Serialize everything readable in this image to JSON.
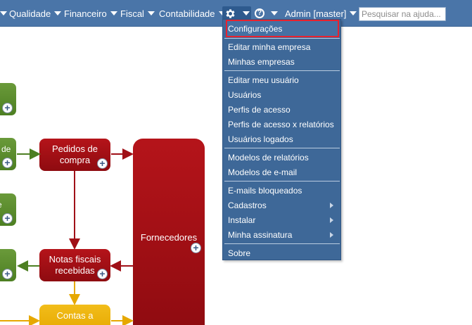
{
  "nav": {
    "items": [
      {
        "label": "Qualidade"
      },
      {
        "label": "Financeiro"
      },
      {
        "label": "Fiscal"
      },
      {
        "label": "Contabilidade"
      }
    ],
    "settings_icon": "gear-icon",
    "help_icon": "help-icon",
    "help_glyph": "?",
    "user_label": "Admin [master]",
    "search_placeholder": "Pesquisar na ajuda..."
  },
  "menu": {
    "items": [
      {
        "label": "Configurações",
        "highlighted": true
      },
      {
        "label": "Editar minha empresa"
      },
      {
        "label": "Minhas empresas"
      },
      {
        "label": "Editar meu usuário"
      },
      {
        "label": "Usuários"
      },
      {
        "label": "Perfis de acesso"
      },
      {
        "label": "Perfis de acesso x relatórios"
      },
      {
        "label": "Usuários logados"
      },
      {
        "label": "Modelos de relatórios"
      },
      {
        "label": "Modelos de e-mail"
      },
      {
        "label": "E-mails bloqueados"
      },
      {
        "label": "Cadastros",
        "submenu": true
      },
      {
        "label": "Instalar",
        "submenu": true
      },
      {
        "label": "Minha assinatura",
        "submenu": true
      },
      {
        "label": "Sobre"
      }
    ]
  },
  "flow": {
    "partial_label_de": "de",
    "partial_label_e": "e",
    "pedidos": "Pedidos de compra",
    "pedidos_line1": "Pedidos de",
    "pedidos_line2": "compra",
    "notas_line1": "Notas fiscais",
    "notas_line2": "recebidas",
    "contas_line1": "Contas a",
    "fornecedores": "Fornecedores",
    "plus_glyph": "+"
  },
  "colors": {
    "navbar": "#4a75a8",
    "menu": "#3e6898",
    "highlight_border": "#e8222e",
    "box_red": "#a01017",
    "box_green": "#5a8a2c",
    "box_yellow": "#f0b400"
  }
}
